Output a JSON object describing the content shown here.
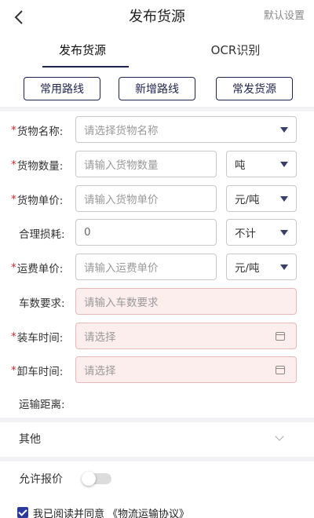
{
  "header": {
    "title": "发布货源",
    "right_action": "默认设置",
    "back_icon": "chevron-left-icon"
  },
  "tabs": [
    {
      "label": "发布货源",
      "active": true
    },
    {
      "label": "OCR识别",
      "active": false
    }
  ],
  "quick_buttons": [
    "常用路线",
    "新增路线",
    "常发货源"
  ],
  "form": {
    "goods_name": {
      "label": "货物名称:",
      "required": true,
      "placeholder": "请选择货物名称"
    },
    "goods_qty": {
      "label": "货物数量:",
      "required": true,
      "placeholder": "请输入货物数量",
      "unit": "吨"
    },
    "goods_price": {
      "label": "货物单价:",
      "required": true,
      "placeholder": "请输入货物单价",
      "unit": "元/吨"
    },
    "loss": {
      "label": "合理损耗:",
      "required": false,
      "value": "0",
      "unit": "不计"
    },
    "freight_price": {
      "label": "运费单价:",
      "required": true,
      "placeholder": "请输入运费单价",
      "unit": "元/吨"
    },
    "truck_count": {
      "label": "车数要求:",
      "required": false,
      "placeholder": "请输入车数要求"
    },
    "load_time": {
      "label": "装车时间:",
      "required": true,
      "placeholder": "请选择"
    },
    "unload_time": {
      "label": "卸车时间:",
      "required": true,
      "placeholder": "请选择"
    },
    "distance": {
      "label": "运输距离:"
    }
  },
  "other": {
    "label": "其他"
  },
  "allow_quote": {
    "label": "允许报价",
    "enabled": false
  },
  "agreement": {
    "text": "我已阅读并同意",
    "link": "《物流运输协议》",
    "checked": true
  },
  "colors": {
    "accent": "#1f2350",
    "required": "#d3262c",
    "checkbox": "#2a3a9c",
    "pink_field": "#fdeeee"
  }
}
